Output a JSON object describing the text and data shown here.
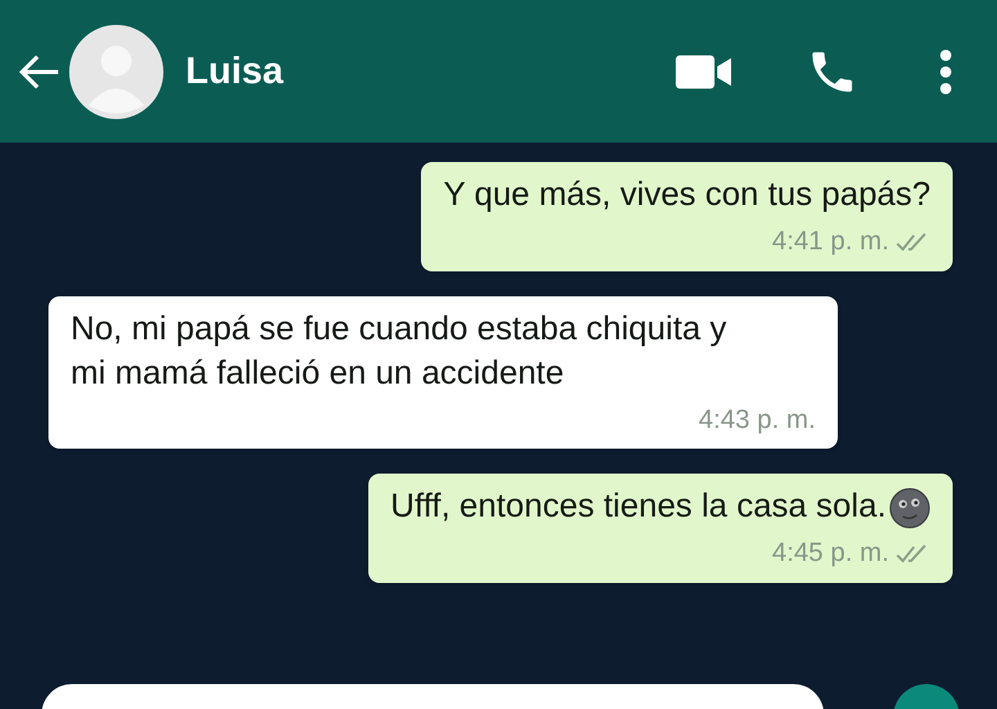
{
  "header": {
    "contact_name": "Luisa"
  },
  "messages": [
    {
      "kind": "outgoing",
      "text": "Y que más, vives con tus papás?",
      "time": "4:41 p. m.",
      "read": false
    },
    {
      "kind": "incoming",
      "text": "No, mi papá se fue cuando estaba chiquita y mi mamá falleció en un accidente",
      "time": "4:43 p. m."
    },
    {
      "kind": "outgoing",
      "text": "Ufff, entonces tienes la casa sola.",
      "time": "4:45 p. m.",
      "read": false,
      "emoji": true
    }
  ]
}
